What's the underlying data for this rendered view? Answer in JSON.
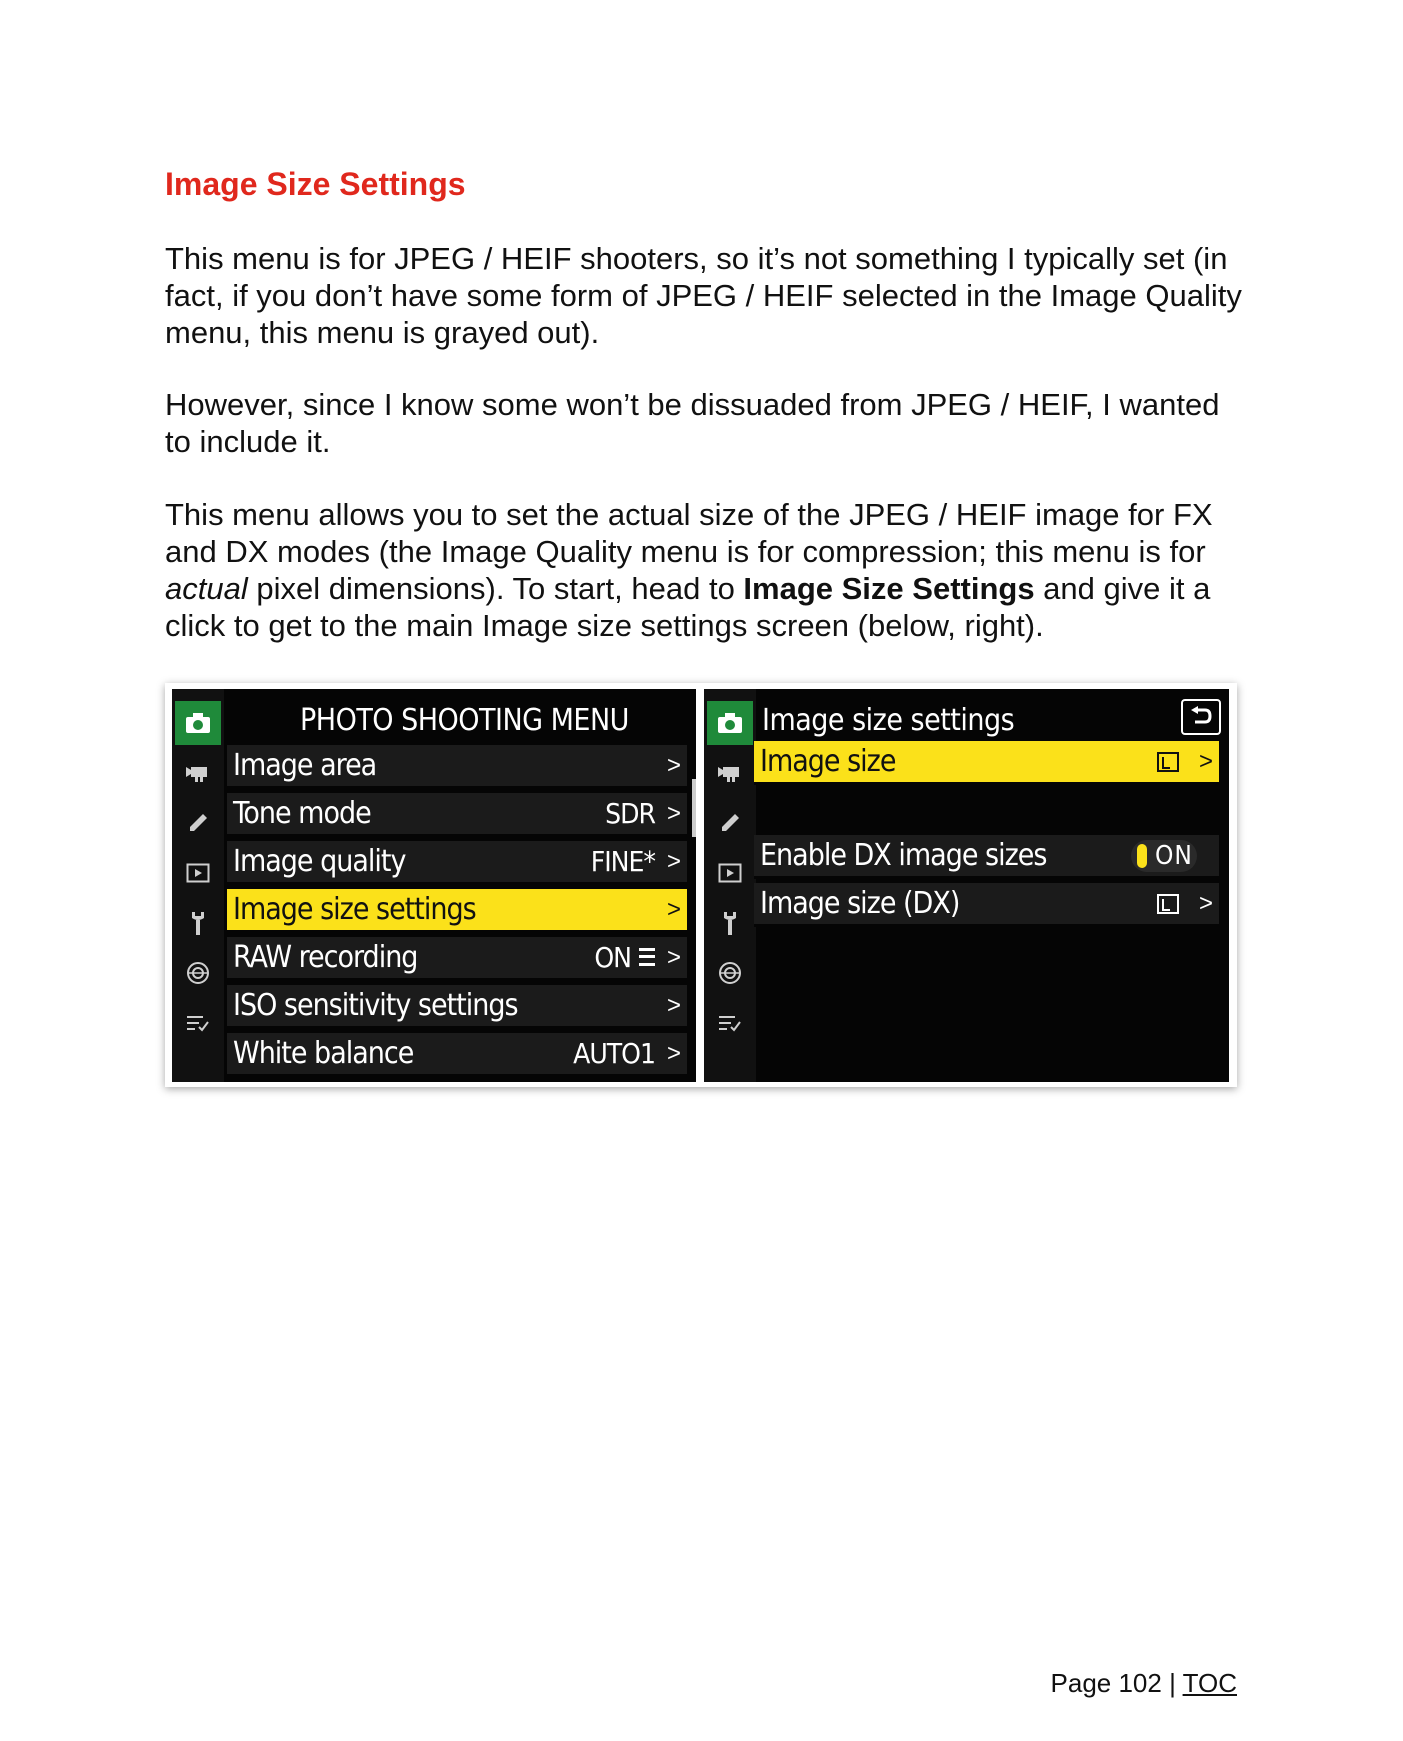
{
  "heading": "Image Size Settings",
  "paragraphs": {
    "p1": "This menu is for JPEG / HEIF shooters, so it’s not something I typically set (in fact, if you don’t have some form of JPEG / HEIF selected in the Image Quality menu, this menu is grayed out).",
    "p2": "However, since I know some won’t be dissuaded from JPEG / HEIF, I wanted to include it.",
    "p3_a": "This menu allows you to set the actual size of the JPEG / HEIF image for FX and DX modes (the Image Quality menu is for compression; this menu is for ",
    "p3_em": "actual",
    "p3_b": " pixel dimensions). To start, head to ",
    "p3_strong": "Image Size Settings",
    "p3_c": " and give it a click to get to the main Image size settings screen (below, right)."
  },
  "left_screen": {
    "title": "PHOTO SHOOTING MENU",
    "icons": [
      "camera-icon",
      "movie-icon",
      "pencil-icon",
      "playback-icon",
      "wrench-icon",
      "network-icon",
      "my-menu-icon"
    ],
    "rows": [
      {
        "label": "Image area",
        "value": "",
        "chevron": ">"
      },
      {
        "label": "Tone mode",
        "value": "SDR",
        "chevron": ">"
      },
      {
        "label": "Image quality",
        "value": "FINE*",
        "chevron": ">"
      },
      {
        "label": "Image size settings",
        "value": "",
        "chevron": ">"
      },
      {
        "label": "RAW recording",
        "value": "ON",
        "chevron": ">"
      },
      {
        "label": "ISO sensitivity settings",
        "value": "",
        "chevron": ">"
      },
      {
        "label": "White balance",
        "value": "AUTO1",
        "chevron": ">"
      }
    ]
  },
  "right_screen": {
    "title": "Image size settings",
    "rows": [
      {
        "label": "Image size",
        "chevron": ">"
      },
      {
        "label": "Enable DX image sizes",
        "toggle": "ON"
      },
      {
        "label": "Image size (DX)",
        "chevron": ">"
      }
    ]
  },
  "colors": {
    "heading": "#e0281d",
    "highlight": "#fbe11a",
    "camera_tab": "#1f8a3a"
  },
  "footer": {
    "page": "Page 102",
    "separator": " | ",
    "toc": "TOC"
  }
}
